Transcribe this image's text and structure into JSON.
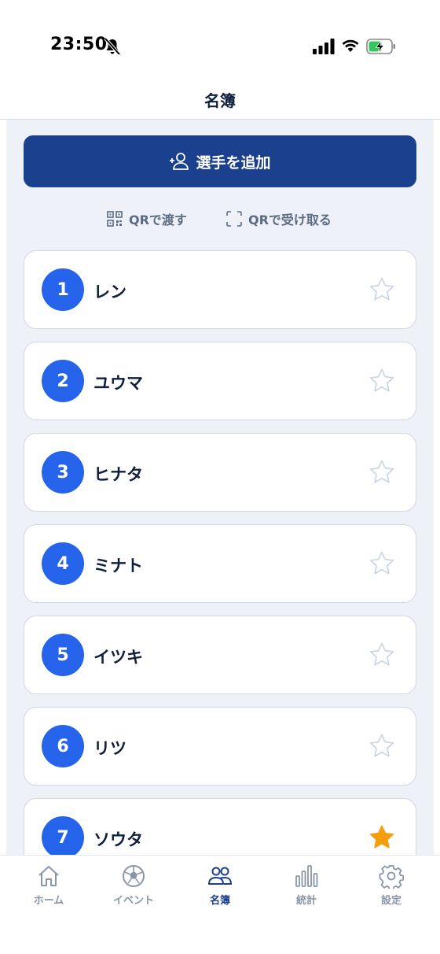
{
  "status_bar": {
    "time": "23:50"
  },
  "header": {
    "title": "名簿"
  },
  "actions": {
    "add_player_label": "選手を追加",
    "qr_send_label": "QRで渡す",
    "qr_receive_label": "QRで受け取る"
  },
  "players": [
    {
      "number": "1",
      "name": "レン",
      "favorite": false
    },
    {
      "number": "2",
      "name": "ユウマ",
      "favorite": false
    },
    {
      "number": "3",
      "name": "ヒナタ",
      "favorite": false
    },
    {
      "number": "4",
      "name": "ミナト",
      "favorite": false
    },
    {
      "number": "5",
      "name": "イツキ",
      "favorite": false
    },
    {
      "number": "6",
      "name": "リツ",
      "favorite": false
    },
    {
      "number": "7",
      "name": "ソウタ",
      "favorite": true
    }
  ],
  "tabs": [
    {
      "label": "ホーム",
      "icon": "home-icon",
      "active": false
    },
    {
      "label": "イベント",
      "icon": "soccer-ball-icon",
      "active": false
    },
    {
      "label": "名簿",
      "icon": "people-icon",
      "active": true
    },
    {
      "label": "統計",
      "icon": "bar-chart-icon",
      "active": false
    },
    {
      "label": "設定",
      "icon": "gear-icon",
      "active": false
    }
  ],
  "colors": {
    "primary": "#1b418e",
    "badge": "#2563eb",
    "star_active": "#f59e0b",
    "star_inactive": "#c9d3e2",
    "background": "#eef2f8"
  }
}
